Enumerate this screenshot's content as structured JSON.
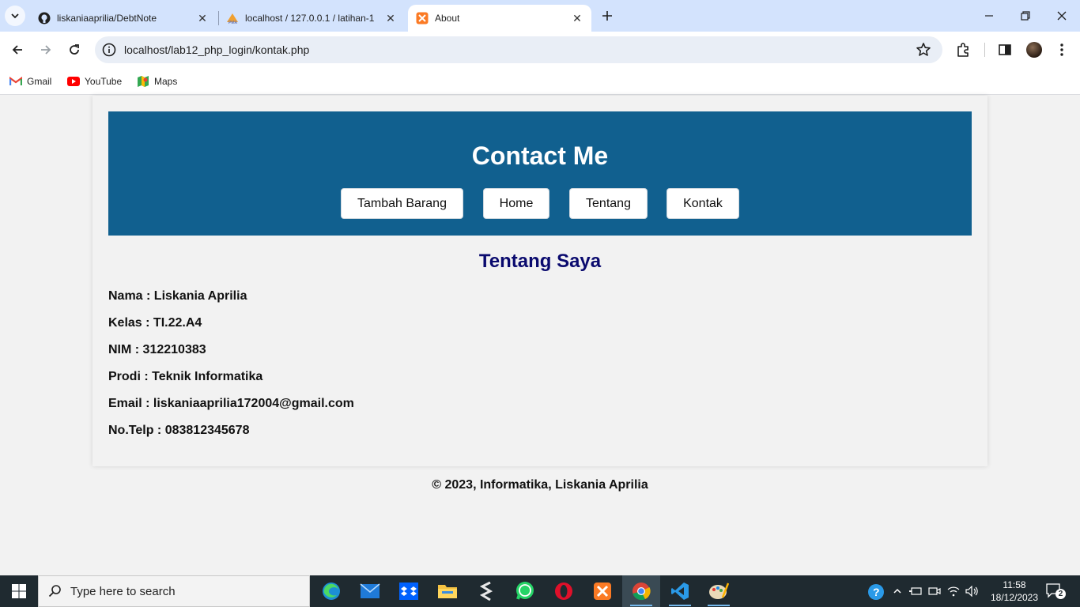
{
  "browser": {
    "tabs": [
      {
        "title": "liskaniaaprilia/DebtNote",
        "icon": "github-icon",
        "active": false
      },
      {
        "title": "localhost / 127.0.0.1 / latihan-1",
        "icon": "phpmyadmin-icon",
        "active": false
      },
      {
        "title": "About",
        "icon": "xampp-icon",
        "active": true
      }
    ],
    "url": "localhost/lab12_php_login/kontak.php",
    "bookmarks": [
      {
        "label": "Gmail",
        "icon": "gmail-icon"
      },
      {
        "label": "YouTube",
        "icon": "youtube-icon"
      },
      {
        "label": "Maps",
        "icon": "maps-icon"
      }
    ]
  },
  "page": {
    "header_title": "Contact Me",
    "nav": [
      "Tambah Barang",
      "Home",
      "Tentang",
      "Kontak"
    ],
    "section_title": "Tentang Saya",
    "info": [
      "Nama : Liskania Aprilia",
      "Kelas : TI.22.A4",
      "NIM : 312210383",
      "Prodi : Teknik Informatika",
      "Email : liskaniaaprilia172004@gmail.com",
      "No.Telp : 083812345678"
    ],
    "footer": "© 2023, Informatika, Liskania Aprilia"
  },
  "taskbar": {
    "search_placeholder": "Type here to search",
    "time": "11:58",
    "date": "18/12/2023",
    "notification_count": "2",
    "apps": [
      "edge-icon",
      "mail-icon",
      "dropbox-icon",
      "file-explorer-icon",
      "sublime-icon",
      "whatsapp-icon",
      "opera-icon",
      "xampp-icon",
      "chrome-icon",
      "vscode-icon",
      "paint-icon"
    ]
  },
  "colors": {
    "header_bg": "#11608f",
    "section_title": "#0a0a6e",
    "page_bg": "#f2f2f2"
  }
}
